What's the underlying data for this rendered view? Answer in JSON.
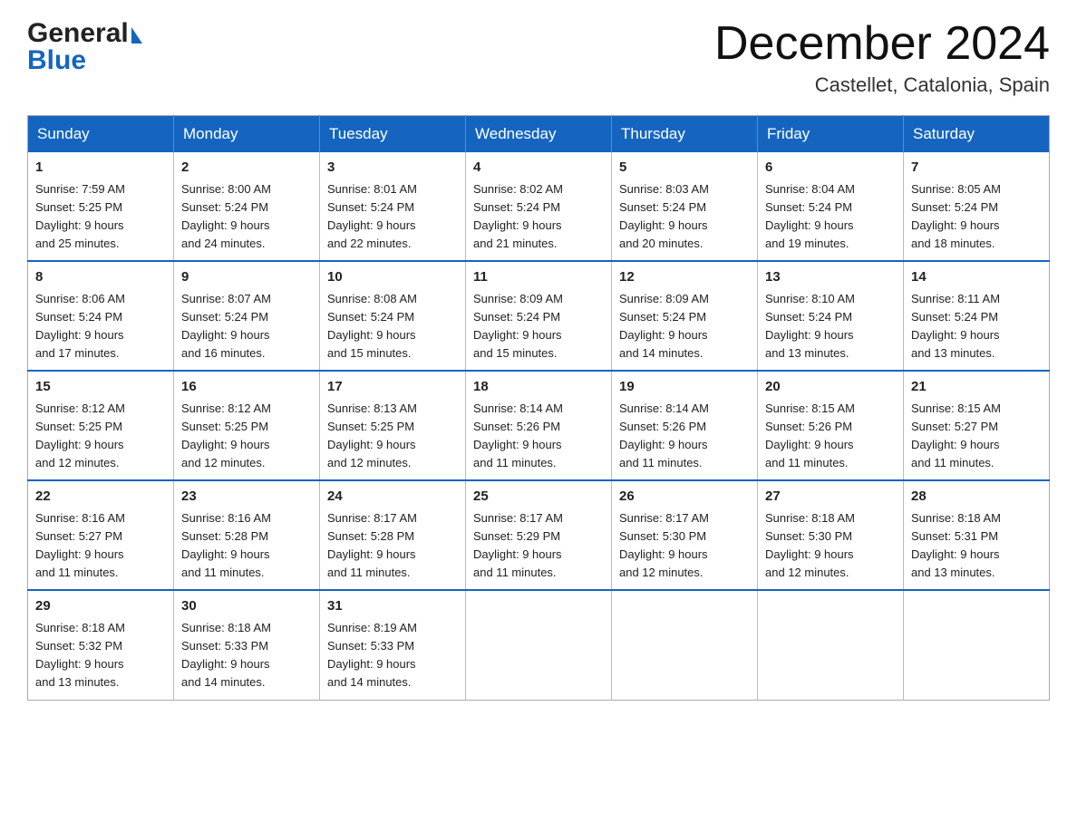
{
  "header": {
    "logo": {
      "general": "General",
      "blue": "Blue",
      "arrow_color": "#1565c0"
    },
    "month_title": "December 2024",
    "location": "Castellet, Catalonia, Spain"
  },
  "days_of_week": [
    "Sunday",
    "Monday",
    "Tuesday",
    "Wednesday",
    "Thursday",
    "Friday",
    "Saturday"
  ],
  "weeks": [
    [
      {
        "day": "1",
        "sunrise": "7:59 AM",
        "sunset": "5:25 PM",
        "daylight": "9 hours and 25 minutes."
      },
      {
        "day": "2",
        "sunrise": "8:00 AM",
        "sunset": "5:24 PM",
        "daylight": "9 hours and 24 minutes."
      },
      {
        "day": "3",
        "sunrise": "8:01 AM",
        "sunset": "5:24 PM",
        "daylight": "9 hours and 22 minutes."
      },
      {
        "day": "4",
        "sunrise": "8:02 AM",
        "sunset": "5:24 PM",
        "daylight": "9 hours and 21 minutes."
      },
      {
        "day": "5",
        "sunrise": "8:03 AM",
        "sunset": "5:24 PM",
        "daylight": "9 hours and 20 minutes."
      },
      {
        "day": "6",
        "sunrise": "8:04 AM",
        "sunset": "5:24 PM",
        "daylight": "9 hours and 19 minutes."
      },
      {
        "day": "7",
        "sunrise": "8:05 AM",
        "sunset": "5:24 PM",
        "daylight": "9 hours and 18 minutes."
      }
    ],
    [
      {
        "day": "8",
        "sunrise": "8:06 AM",
        "sunset": "5:24 PM",
        "daylight": "9 hours and 17 minutes."
      },
      {
        "day": "9",
        "sunrise": "8:07 AM",
        "sunset": "5:24 PM",
        "daylight": "9 hours and 16 minutes."
      },
      {
        "day": "10",
        "sunrise": "8:08 AM",
        "sunset": "5:24 PM",
        "daylight": "9 hours and 15 minutes."
      },
      {
        "day": "11",
        "sunrise": "8:09 AM",
        "sunset": "5:24 PM",
        "daylight": "9 hours and 15 minutes."
      },
      {
        "day": "12",
        "sunrise": "8:09 AM",
        "sunset": "5:24 PM",
        "daylight": "9 hours and 14 minutes."
      },
      {
        "day": "13",
        "sunrise": "8:10 AM",
        "sunset": "5:24 PM",
        "daylight": "9 hours and 13 minutes."
      },
      {
        "day": "14",
        "sunrise": "8:11 AM",
        "sunset": "5:24 PM",
        "daylight": "9 hours and 13 minutes."
      }
    ],
    [
      {
        "day": "15",
        "sunrise": "8:12 AM",
        "sunset": "5:25 PM",
        "daylight": "9 hours and 12 minutes."
      },
      {
        "day": "16",
        "sunrise": "8:12 AM",
        "sunset": "5:25 PM",
        "daylight": "9 hours and 12 minutes."
      },
      {
        "day": "17",
        "sunrise": "8:13 AM",
        "sunset": "5:25 PM",
        "daylight": "9 hours and 12 minutes."
      },
      {
        "day": "18",
        "sunrise": "8:14 AM",
        "sunset": "5:26 PM",
        "daylight": "9 hours and 11 minutes."
      },
      {
        "day": "19",
        "sunrise": "8:14 AM",
        "sunset": "5:26 PM",
        "daylight": "9 hours and 11 minutes."
      },
      {
        "day": "20",
        "sunrise": "8:15 AM",
        "sunset": "5:26 PM",
        "daylight": "9 hours and 11 minutes."
      },
      {
        "day": "21",
        "sunrise": "8:15 AM",
        "sunset": "5:27 PM",
        "daylight": "9 hours and 11 minutes."
      }
    ],
    [
      {
        "day": "22",
        "sunrise": "8:16 AM",
        "sunset": "5:27 PM",
        "daylight": "9 hours and 11 minutes."
      },
      {
        "day": "23",
        "sunrise": "8:16 AM",
        "sunset": "5:28 PM",
        "daylight": "9 hours and 11 minutes."
      },
      {
        "day": "24",
        "sunrise": "8:17 AM",
        "sunset": "5:28 PM",
        "daylight": "9 hours and 11 minutes."
      },
      {
        "day": "25",
        "sunrise": "8:17 AM",
        "sunset": "5:29 PM",
        "daylight": "9 hours and 11 minutes."
      },
      {
        "day": "26",
        "sunrise": "8:17 AM",
        "sunset": "5:30 PM",
        "daylight": "9 hours and 12 minutes."
      },
      {
        "day": "27",
        "sunrise": "8:18 AM",
        "sunset": "5:30 PM",
        "daylight": "9 hours and 12 minutes."
      },
      {
        "day": "28",
        "sunrise": "8:18 AM",
        "sunset": "5:31 PM",
        "daylight": "9 hours and 13 minutes."
      }
    ],
    [
      {
        "day": "29",
        "sunrise": "8:18 AM",
        "sunset": "5:32 PM",
        "daylight": "9 hours and 13 minutes."
      },
      {
        "day": "30",
        "sunrise": "8:18 AM",
        "sunset": "5:33 PM",
        "daylight": "9 hours and 14 minutes."
      },
      {
        "day": "31",
        "sunrise": "8:19 AM",
        "sunset": "5:33 PM",
        "daylight": "9 hours and 14 minutes."
      },
      null,
      null,
      null,
      null
    ]
  ],
  "labels": {
    "sunrise_prefix": "Sunrise: ",
    "sunset_prefix": "Sunset: ",
    "daylight_prefix": "Daylight: "
  }
}
